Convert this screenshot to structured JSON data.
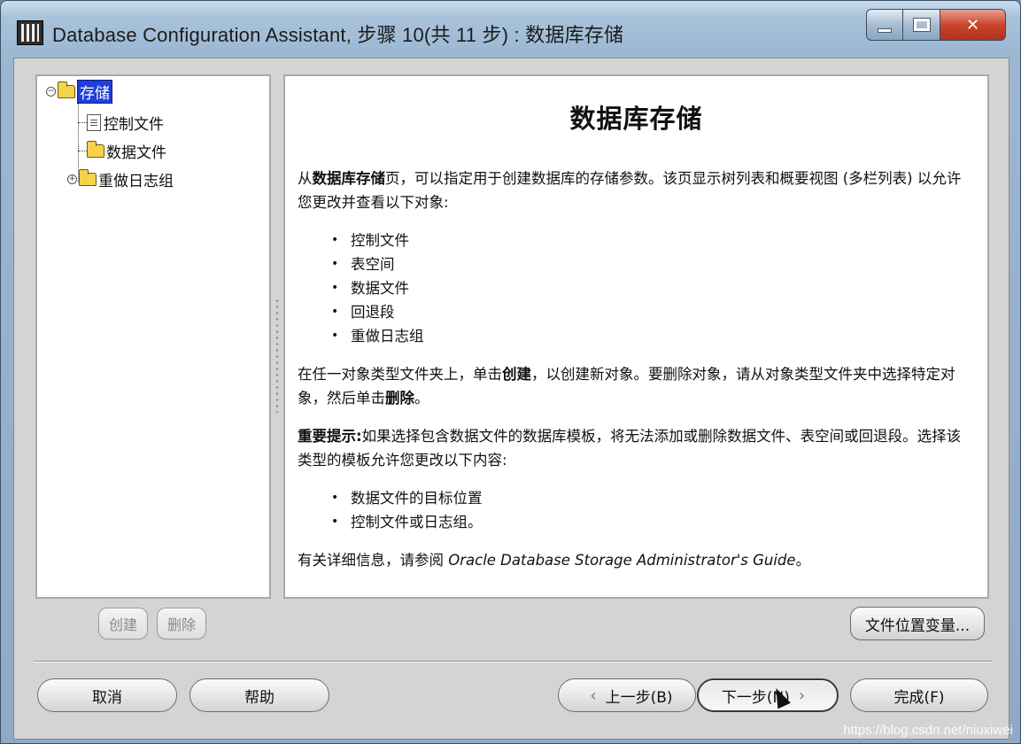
{
  "window": {
    "title": "Database Configuration Assistant, 步骤 10(共 11 步) : 数据库存储"
  },
  "tree": {
    "root": "存储",
    "children": [
      "控制文件",
      "数据文件",
      "重做日志组"
    ]
  },
  "content": {
    "title": "数据库存储",
    "intro_prefix": "从",
    "intro_bold": "数据库存储",
    "intro_suffix": "页，可以指定用于创建数据库的存储参数。该页显示树列表和概要视图 (多栏列表) 以允许您更改并查看以下对象:",
    "objects": [
      "控制文件",
      "表空间",
      "数据文件",
      "回退段",
      "重做日志组"
    ],
    "create_prefix": "在任一对象类型文件夹上，单击",
    "create_bold": "创建",
    "create_mid": "，以创建新对象。要删除对象，请从对象类型文件夹中选择特定对象，然后单击",
    "delete_bold": "删除",
    "create_suffix": "。",
    "note_bold": "重要提示:",
    "note_text": "如果选择包含数据文件的数据库模板，将无法添加或删除数据文件、表空间或回退段。选择该类型的模板允许您更改以下内容:",
    "note_items": [
      "数据文件的目标位置",
      "控制文件或日志组。"
    ],
    "ref_prefix": "有关详细信息，请参阅 ",
    "ref_italic": "Oracle Database Storage Administrator's Guide",
    "ref_suffix": "。"
  },
  "buttons": {
    "create": "创建",
    "delete": "删除",
    "file_location_vars": "文件位置变量...",
    "cancel": "取消",
    "help": "帮助",
    "back": "上一步(B)",
    "next": "下一步(N)",
    "finish": "完成(F)"
  },
  "watermark": "https://blog.csdn.net/niuxiwei"
}
